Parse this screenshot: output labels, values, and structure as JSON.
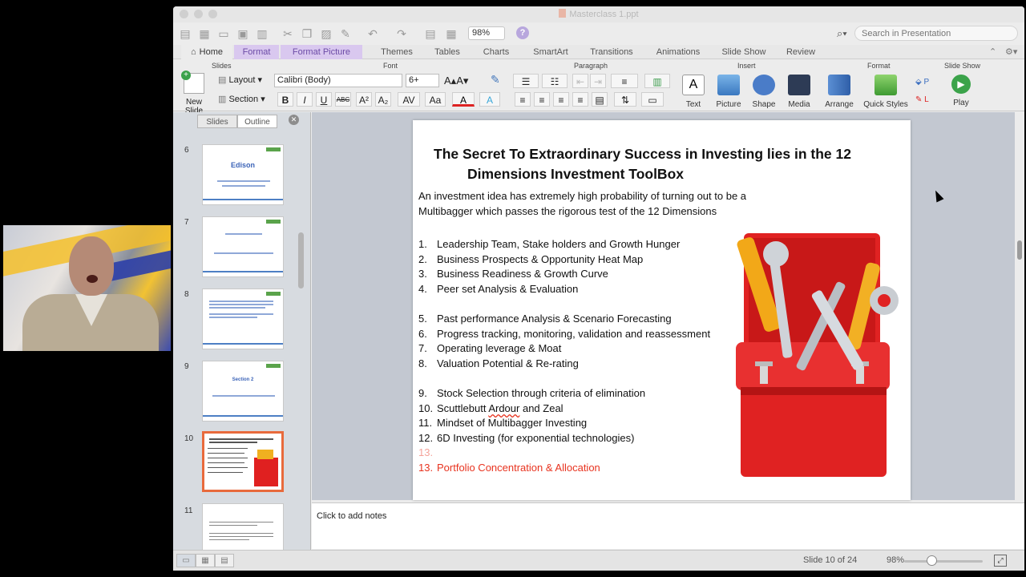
{
  "window": {
    "title": "Masterclass 1.ppt"
  },
  "toolbar": {
    "zoom": "98%",
    "help": "?"
  },
  "search": {
    "placeholder": "Search in Presentation"
  },
  "tabs": [
    "Home",
    "Format",
    "Format Picture",
    "Themes",
    "Tables",
    "Charts",
    "SmartArt",
    "Transitions",
    "Animations",
    "Slide Show",
    "Review"
  ],
  "ribbon": {
    "groups": {
      "slides": "Slides",
      "font": "Font",
      "paragraph": "Paragraph",
      "insert": "Insert",
      "format": "Format",
      "slideshow": "Slide Show"
    },
    "new_slide": "New Slide",
    "layout": "Layout",
    "section": "Section",
    "font_name": "Calibri (Body)",
    "font_size": "6+",
    "text": "Text",
    "picture": "Picture",
    "shape": "Shape",
    "media": "Media",
    "arrange": "Arrange",
    "quick_styles": "Quick Styles",
    "play": "Play",
    "bold": "B",
    "italic": "I",
    "underline": "U",
    "strike": "ABC"
  },
  "sidebar": {
    "tabs": [
      "Slides",
      "Outline"
    ],
    "slides": [
      {
        "num": "6",
        "title": "Edison"
      },
      {
        "num": "7",
        "title": ""
      },
      {
        "num": "8",
        "title": ""
      },
      {
        "num": "9",
        "title": "Section 2"
      },
      {
        "num": "10",
        "title": ""
      },
      {
        "num": "11",
        "title": ""
      }
    ]
  },
  "slide": {
    "title_line1": "The Secret To Extraordinary Success in Investing lies in the 12",
    "title_line2": "Dimensions Investment ToolBox",
    "intro": "An investment idea has extremely high probability of turning out to be a Multibagger which passes the rigorous test of the 12 Dimensions",
    "items": [
      {
        "n": "1.",
        "text": "Leadership Team, Stake holders and Growth Hunger"
      },
      {
        "n": "2.",
        "text": "Business Prospects & Opportunity Heat Map"
      },
      {
        "n": "3.",
        "text": "Business Readiness & Growth Curve"
      },
      {
        "n": "4.",
        "text": "Peer set Analysis & Evaluation"
      },
      {
        "n": "5.",
        "text": "Past performance Analysis & Scenario Forecasting"
      },
      {
        "n": "6.",
        "text": "Progress tracking, monitoring, validation and reassessment"
      },
      {
        "n": "7.",
        "text": "Operating leverage & Moat"
      },
      {
        "n": "8.",
        "text": "Valuation Potential & Re-rating"
      },
      {
        "n": "9.",
        "text": "Stock Selection through criteria of elimination"
      },
      {
        "n": "10.",
        "text_a": "Scuttlebutt ",
        "text_b": "Ardour",
        "text_c": " and Zeal"
      },
      {
        "n": "11.",
        "text": "Mindset of Multibagger Investing"
      },
      {
        "n": "12.",
        "text": "6D Investing (for exponential technologies)"
      },
      {
        "n": "13.",
        "text": ""
      },
      {
        "n": "13.",
        "text": "Portfolio Concentration & Allocation"
      }
    ]
  },
  "notes": {
    "placeholder": "Click to add notes"
  },
  "status": {
    "slide_info": "Slide 10 of 24",
    "zoom": "98%"
  },
  "colors": {
    "accent_red": "#e8331f",
    "tab_purple": "#d9c8ef",
    "selected_thumb": "#e86a3c"
  }
}
